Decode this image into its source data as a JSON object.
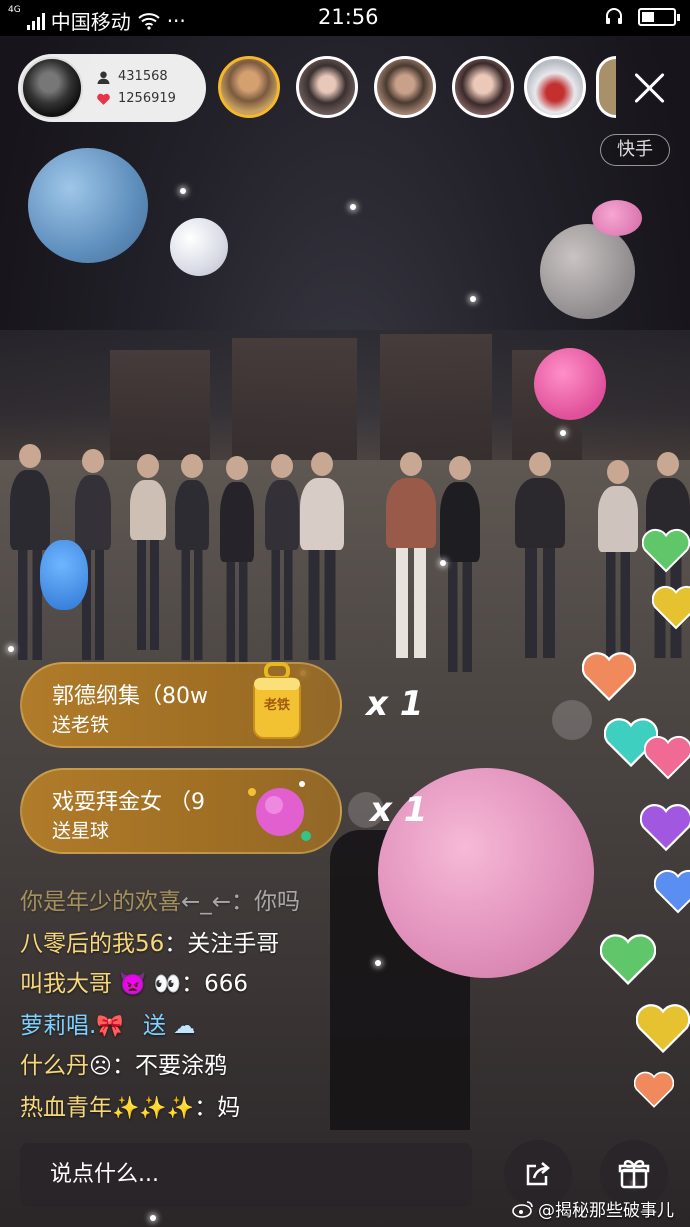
{
  "status_bar": {
    "network_badge": "4G",
    "carrier": "中国移动",
    "more": "···",
    "time": "21:56"
  },
  "host": {
    "viewers": "431568",
    "likes": "1256919"
  },
  "watermark": "快手",
  "gifts": [
    {
      "sender": "郭德纲集（80w",
      "action": "送老铁",
      "gift_name": "老铁",
      "multiplier": "x 1"
    },
    {
      "sender": "戏耍拜金女 （9",
      "action": "送星球",
      "multiplier": "x 1"
    }
  ],
  "comments": [
    {
      "name": "你是年少的欢喜",
      "sep": "",
      "msg": "←_←：你吗"
    },
    {
      "name": "八零后的我56",
      "sep": "：",
      "msg": "关注手哥"
    },
    {
      "name": "叫我大哥",
      "emoji": "👿 👀",
      "sep": "：",
      "msg": "666"
    },
    {
      "name": "萝莉唱.",
      "emoji": "🎀",
      "msg": "送",
      "emoji2": "☁"
    },
    {
      "name": "什么丹",
      "emoji": "☹",
      "sep": "：",
      "msg": "不要涂鸦"
    },
    {
      "name": "热血青年",
      "emoji": "✨✨✨",
      "sep": "：",
      "msg": "妈"
    }
  ],
  "input": {
    "placeholder": "说点什么..."
  },
  "credit": "@揭秘那些破事儿",
  "colors": {
    "gift_banner": "#a8762a",
    "name_gold": "#f6d77c",
    "name_blue": "#7fd1ff"
  }
}
